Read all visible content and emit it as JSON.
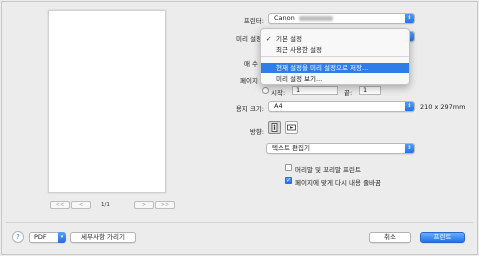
{
  "preview": {
    "page_counter": "1/1",
    "nav": {
      "first": "<<",
      "prev": "<",
      "next": ">",
      "last": ">>"
    }
  },
  "printer": {
    "label": "프린터:",
    "value": "Canon"
  },
  "presets": {
    "label": "미리 설정",
    "menu": {
      "items": [
        {
          "label": "기본 설정",
          "checked": true
        },
        {
          "label": "최근 사용한 설정",
          "checked": false
        },
        {
          "label": "현재 설정을 미리 설정으로 저장...",
          "checked": false,
          "selected": true
        },
        {
          "label": "미리 설정 보기...",
          "checked": false
        }
      ]
    }
  },
  "copies": {
    "label": "매 수"
  },
  "pages": {
    "label": "페이지",
    "from_label": "시작:",
    "from_value": "1",
    "to_label": "끝:",
    "to_value": "1"
  },
  "paper_size": {
    "label": "용지 크기:",
    "value": "A4",
    "dimensions": "210 x 297mm"
  },
  "orientation": {
    "label": "방향:"
  },
  "section_popup": {
    "value": "텍스트 편집기"
  },
  "options": {
    "header_footer": {
      "label": "머리말 및 꼬리말 프린트",
      "checked": false
    },
    "rewrap": {
      "label": "페이지에 맞게 다시 내용 줄바꿈",
      "checked": true
    }
  },
  "footer": {
    "help": "?",
    "pdf_label": "PDF",
    "hide_details_label": "세부사항 가리기",
    "cancel_label": "취소",
    "print_label": "프린트"
  },
  "colors": {
    "accent": "#2f7de9"
  }
}
